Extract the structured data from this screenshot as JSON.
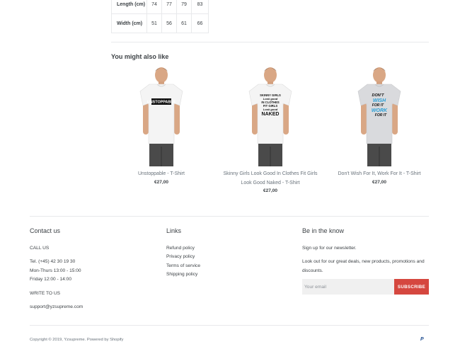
{
  "size_table": {
    "rows": [
      {
        "label": "Length (cm)",
        "values": [
          "74",
          "77",
          "79",
          "83"
        ]
      },
      {
        "label": "Width (cm)",
        "values": [
          "51",
          "56",
          "61",
          "66"
        ]
      }
    ]
  },
  "related": {
    "title": "You might also like",
    "products": [
      {
        "name": "Unstoppable - T-Shirt",
        "price": "€27,00",
        "shirt_color": "#f4f4f4",
        "print": "unstoppable"
      },
      {
        "name": "Skinny Girls Look Good In Clothes Fit Girls Look Good Naked - T-Shirt",
        "price": "€27,00",
        "shirt_color": "#f4f4f4",
        "print": "skinny"
      },
      {
        "name": "Don't Wish For It, Work For It - T-Shirt",
        "price": "€27,00",
        "shirt_color": "#d9dadd",
        "print": "dontwish"
      }
    ]
  },
  "footer": {
    "contact": {
      "title": "Contact us",
      "call_label": "CALL US",
      "phone": "Tel. (+45) 42 30 19 30",
      "hours1": "Mon-Thurs 13:00 - 15:00",
      "hours2": "Friday 12:00 - 14:00",
      "write_label": "WRITE TO US",
      "email": "support@yzsupreme.com"
    },
    "links": {
      "title": "Links",
      "items": [
        "Refund policy",
        "Privacy policy",
        "Terms of service",
        "Shipping policy"
      ]
    },
    "newsletter": {
      "title": "Be in the know",
      "text1": "Sign up for our newsletter.",
      "text2": "Look out for our great deals, new products, promotions and discounts.",
      "placeholder": "Your email",
      "button": "SUBSCRIBE",
      "button_color": "#d5473f"
    },
    "copyright": "Copyright © 2019, Yzsupreme. Powered by Shopify",
    "payment_icon": "paypal-icon",
    "payment_text": "P"
  }
}
